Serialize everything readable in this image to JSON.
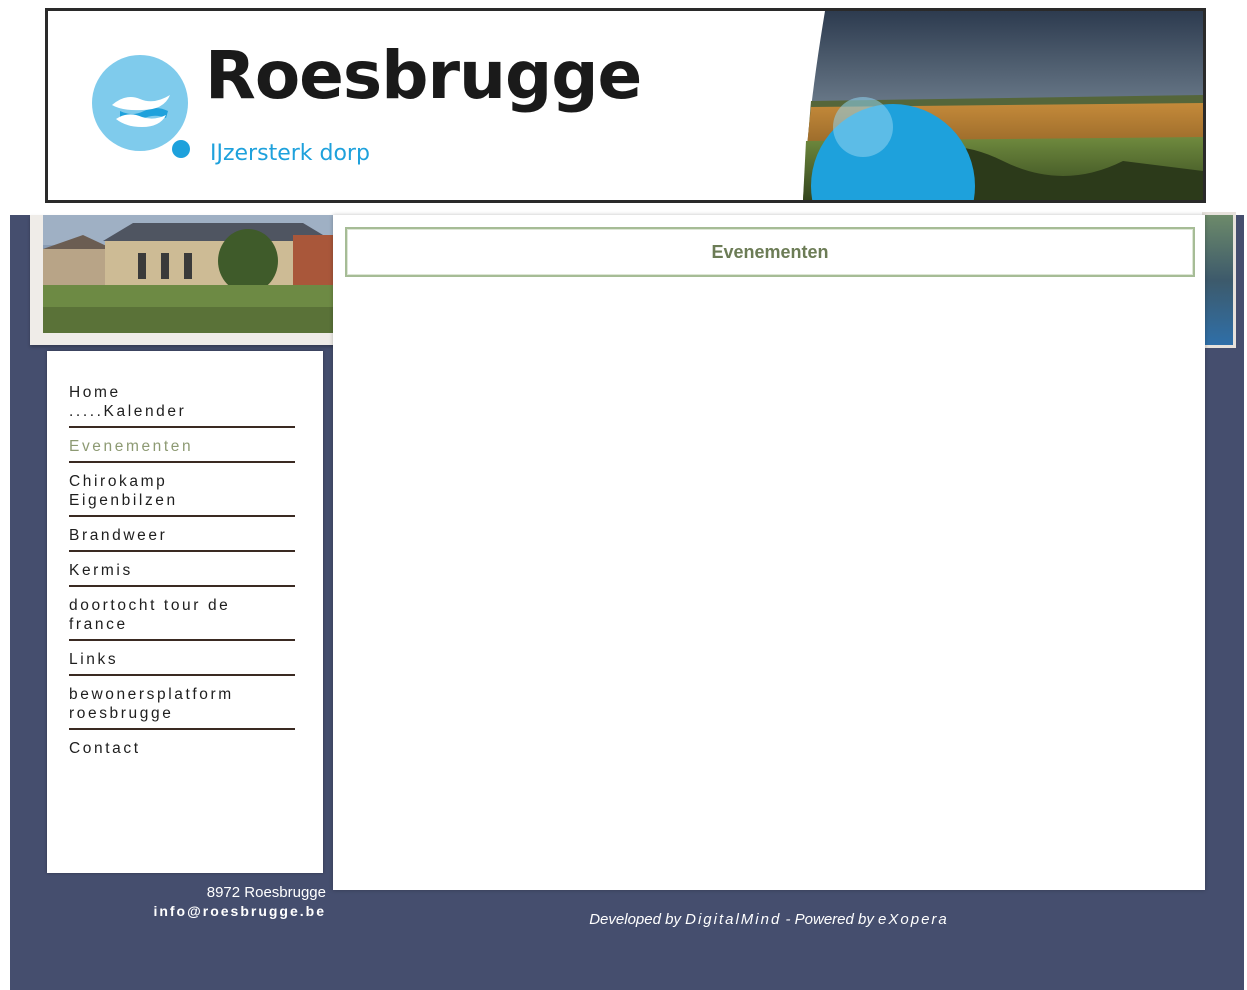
{
  "header": {
    "brand_name": "Roesbrugge",
    "tagline": "IJzersterk dorp",
    "colors": {
      "brand_blue": "#1ea1dc",
      "light_blue": "#7fcbec",
      "ink": "#1a1a1a"
    }
  },
  "nav": {
    "items": [
      {
        "label": "Home\n.....Kalender",
        "active": false
      },
      {
        "label": "Evenementen",
        "active": true
      },
      {
        "label": "Chirokamp\nEigenbilzen",
        "active": false
      },
      {
        "label": "Brandweer",
        "active": false
      },
      {
        "label": "Kermis",
        "active": false
      },
      {
        "label": "doortocht tour de\nfrance",
        "active": false
      },
      {
        "label": "Links",
        "active": false
      },
      {
        "label": "bewonersplatform\nroesbrugge",
        "active": false
      },
      {
        "label": "Contact",
        "active": false
      }
    ]
  },
  "main": {
    "title": "Evenementen"
  },
  "footer": {
    "address": "8972 Roesbrugge",
    "email": "info@roesbrugge.be",
    "credits": {
      "developed_prefix": "Developed by ",
      "developer": "DigitalMind",
      "separator": " - Powered by ",
      "platform": "eXopera"
    }
  },
  "colors": {
    "page_background": "#454e6e",
    "active_nav": "#8d9a73",
    "title_text": "#6c7c56",
    "title_border": "#a6bc96"
  }
}
